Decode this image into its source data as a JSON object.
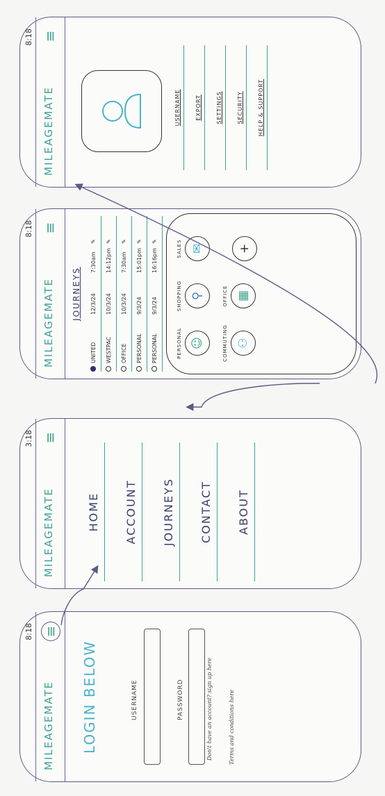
{
  "app": {
    "brand": "MILEAGEMATE",
    "time": "8:18",
    "time_alt": "3:18",
    "menu_glyph": "≡"
  },
  "login": {
    "title": "LOGIN BELOW",
    "username_label": "USERNAME",
    "password_label": "PASSWORD",
    "no_account": "Don't have an account? sign up here",
    "terms": "Terms and conditions here"
  },
  "nav": {
    "items": [
      "HOME",
      "ACCOUNT",
      "JOURNEYS",
      "CONTACT",
      "ABOUT"
    ]
  },
  "journeys": {
    "title": "JOURNEYS",
    "rows": [
      {
        "name": "UNITED",
        "date": "12/3/24",
        "time": "7:30am",
        "filled": true
      },
      {
        "name": "WESTPAC",
        "date": "10/3/24",
        "time": "14:12pm",
        "filled": false
      },
      {
        "name": "OFFICE",
        "date": "10/3/24",
        "time": "7:30am",
        "filled": false
      },
      {
        "name": "PERSONAL",
        "date": "9/3/24",
        "time": "15:01pm",
        "filled": false
      },
      {
        "name": "PERSONAL",
        "date": "9/3/24",
        "time": "16:16pm",
        "filled": false
      }
    ],
    "categories": [
      {
        "label": "PERSONAL",
        "icon": "smiley-icon",
        "glyph": "☺",
        "color": "#3fa58e"
      },
      {
        "label": "SHOPPING",
        "icon": "pin-icon",
        "glyph": "⚲",
        "color": "#4a7fc0"
      },
      {
        "label": "SALES",
        "icon": "mail-icon",
        "glyph": "✉",
        "color": "#4ab3c9"
      },
      {
        "label": "COMMUTING",
        "icon": "people-icon",
        "glyph": "⚇",
        "color": "#4ab3c9"
      },
      {
        "label": "OFFICE",
        "icon": "building-icon",
        "glyph": "▦",
        "color": "#3fa58e"
      },
      {
        "label": "",
        "icon": "plus-icon",
        "glyph": "+",
        "color": "#333333"
      }
    ]
  },
  "account": {
    "items": [
      "USERNAME",
      "EXPORT",
      "SETTINGS",
      "SECURITY",
      "HELP & SUPPORT"
    ],
    "avatar_icon": "person-icon"
  },
  "colors": {
    "teal": "#3fa58e",
    "cyan": "#4ab3c9",
    "purple": "#5c5a86"
  }
}
